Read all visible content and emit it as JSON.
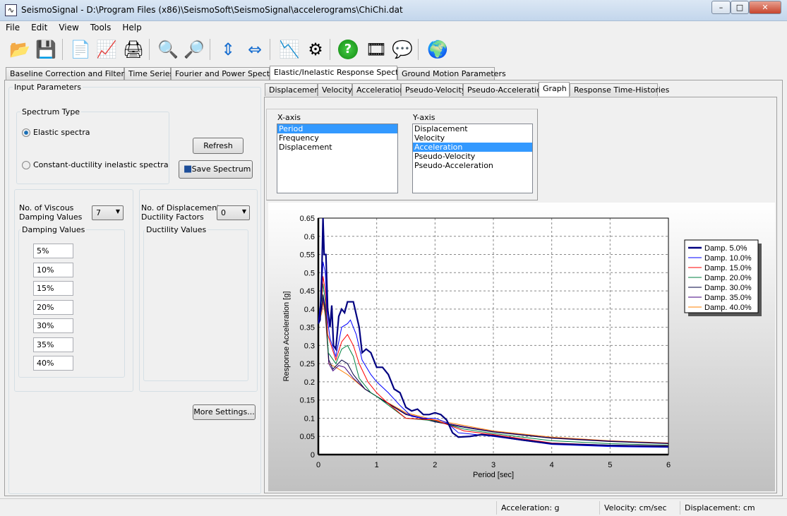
{
  "window": {
    "title": "SeismoSignal - D:\\Program Files (x86)\\SeismoSoft\\SeismoSignal\\accelerograms\\ChiChi.dat",
    "minimize": "–",
    "maximize": "□",
    "close": "✕"
  },
  "menu": [
    "File",
    "Edit",
    "View",
    "Tools",
    "Help"
  ],
  "toolbar": [
    {
      "icon": "open-folder-icon",
      "glyph": "📂"
    },
    {
      "icon": "save-icon",
      "glyph": "💾"
    },
    {
      "icon": "document-icon",
      "glyph": "📄"
    },
    {
      "icon": "signal-document-icon",
      "glyph": "📈"
    },
    {
      "icon": "print-icon",
      "glyph": "🖨"
    },
    {
      "icon": "zoom-in-icon",
      "glyph": "🔍"
    },
    {
      "icon": "zoom-out-icon",
      "glyph": "🔎"
    },
    {
      "icon": "vertical-arrows-icon",
      "glyph": "⇕"
    },
    {
      "icon": "horizontal-arrows-icon",
      "glyph": "⇔"
    },
    {
      "icon": "chart-icon",
      "glyph": "📉"
    },
    {
      "icon": "gear-icon",
      "glyph": "⚙"
    },
    {
      "icon": "help-icon",
      "glyph": "?"
    },
    {
      "icon": "film-reel-icon",
      "glyph": "🎞"
    },
    {
      "icon": "chat-icon",
      "glyph": "💬"
    },
    {
      "icon": "globe-icon",
      "glyph": "🌍"
    }
  ],
  "main_tabs": [
    "Baseline Correction and Filtering",
    "Time Series",
    "Fourier and Power Spectra",
    "Elastic/Inelastic Response Spectra",
    "Ground Motion Parameters"
  ],
  "active_main_tab": 3,
  "input": {
    "title": "Input Parameters",
    "spectrum_type": "Spectrum Type",
    "elastic": "Elastic spectra",
    "inelastic": "Constant-ductility inelastic spectra",
    "selected": "elastic",
    "refresh": "Refresh",
    "save": "Save Spectrum",
    "viscous_label_1": "No. of Viscous",
    "viscous_label_2": "Damping Values",
    "viscous_count": "7",
    "damping_title": "Damping Values",
    "damping_values": [
      "5%",
      "10%",
      "15%",
      "20%",
      "30%",
      "35%",
      "40%"
    ],
    "ductility_label_1": "No. of Displacement",
    "ductility_label_2": "Ductility Factors",
    "ductility_count": "0",
    "ductility_title": "Ductility Values",
    "more": "More Settings..."
  },
  "sub_tabs": [
    "Displacement",
    "Velocity",
    "Acceleration",
    "Pseudo-Velocity",
    "Pseudo-Acceleration",
    "Graph",
    "Response Time-Histories"
  ],
  "active_sub_tab": 5,
  "axes": {
    "x_title": "X-axis",
    "x_options": [
      "Period",
      "Frequency",
      "Displacement"
    ],
    "x_selected": 0,
    "y_title": "Y-axis",
    "y_options": [
      "Displacement",
      "Velocity",
      "Acceleration",
      "Pseudo-Velocity",
      "Pseudo-Acceleration"
    ],
    "y_selected": 2
  },
  "chart_data": {
    "type": "line",
    "xlabel": "Period [sec]",
    "ylabel": "Response Acceleration [g]",
    "xlim": [
      0,
      6
    ],
    "ylim": [
      0,
      0.65
    ],
    "xticks": [
      0,
      1,
      2,
      3,
      4,
      5,
      6
    ],
    "yticks": [
      0,
      0.05,
      0.1,
      0.15,
      0.2,
      0.25,
      0.3,
      0.35,
      0.4,
      0.45,
      0.5,
      0.55,
      0.6,
      0.65
    ],
    "grid": true,
    "legend": "right",
    "series": [
      {
        "name": "Damp. 5.0%",
        "color": "#000080",
        "points": [
          [
            0,
            0.36
          ],
          [
            0.03,
            0.37
          ],
          [
            0.06,
            0.5
          ],
          [
            0.08,
            0.65
          ],
          [
            0.1,
            0.55
          ],
          [
            0.13,
            0.55
          ],
          [
            0.16,
            0.4
          ],
          [
            0.2,
            0.35
          ],
          [
            0.23,
            0.41
          ],
          [
            0.26,
            0.3
          ],
          [
            0.3,
            0.29
          ],
          [
            0.35,
            0.38
          ],
          [
            0.4,
            0.4
          ],
          [
            0.45,
            0.39
          ],
          [
            0.5,
            0.42
          ],
          [
            0.6,
            0.42
          ],
          [
            0.7,
            0.35
          ],
          [
            0.75,
            0.28
          ],
          [
            0.82,
            0.29
          ],
          [
            0.9,
            0.28
          ],
          [
            1.0,
            0.24
          ],
          [
            1.1,
            0.24
          ],
          [
            1.2,
            0.22
          ],
          [
            1.3,
            0.18
          ],
          [
            1.4,
            0.17
          ],
          [
            1.5,
            0.13
          ],
          [
            1.6,
            0.12
          ],
          [
            1.7,
            0.125
          ],
          [
            1.8,
            0.11
          ],
          [
            1.9,
            0.11
          ],
          [
            2.0,
            0.115
          ],
          [
            2.1,
            0.11
          ],
          [
            2.2,
            0.095
          ],
          [
            2.3,
            0.06
          ],
          [
            2.4,
            0.048
          ],
          [
            2.6,
            0.05
          ],
          [
            2.8,
            0.055
          ],
          [
            3,
            0.052
          ],
          [
            3.5,
            0.04
          ],
          [
            4,
            0.03
          ],
          [
            5,
            0.025
          ],
          [
            6,
            0.022
          ]
        ]
      },
      {
        "name": "Damp. 10.0%",
        "color": "#0000ff",
        "points": [
          [
            0,
            0.36
          ],
          [
            0.06,
            0.46
          ],
          [
            0.08,
            0.53
          ],
          [
            0.12,
            0.5
          ],
          [
            0.15,
            0.38
          ],
          [
            0.2,
            0.32
          ],
          [
            0.3,
            0.27
          ],
          [
            0.4,
            0.35
          ],
          [
            0.5,
            0.36
          ],
          [
            0.55,
            0.37
          ],
          [
            0.65,
            0.33
          ],
          [
            0.75,
            0.26
          ],
          [
            0.9,
            0.22
          ],
          [
            1.0,
            0.2
          ],
          [
            1.2,
            0.17
          ],
          [
            1.4,
            0.135
          ],
          [
            1.6,
            0.105
          ],
          [
            1.8,
            0.1
          ],
          [
            2.0,
            0.1
          ],
          [
            2.2,
            0.088
          ],
          [
            2.4,
            0.06
          ],
          [
            2.7,
            0.055
          ],
          [
            3,
            0.05
          ],
          [
            4,
            0.028
          ],
          [
            5,
            0.022
          ],
          [
            6,
            0.02
          ]
        ]
      },
      {
        "name": "Damp. 15.0%",
        "color": "#ff0000",
        "points": [
          [
            0,
            0.36
          ],
          [
            0.06,
            0.44
          ],
          [
            0.08,
            0.49
          ],
          [
            0.12,
            0.45
          ],
          [
            0.16,
            0.33
          ],
          [
            0.22,
            0.3
          ],
          [
            0.3,
            0.26
          ],
          [
            0.4,
            0.31
          ],
          [
            0.5,
            0.33
          ],
          [
            0.6,
            0.3
          ],
          [
            0.7,
            0.25
          ],
          [
            0.85,
            0.2
          ],
          [
            1,
            0.17
          ],
          [
            1.2,
            0.14
          ],
          [
            1.5,
            0.1
          ],
          [
            2,
            0.095
          ],
          [
            2.5,
            0.065
          ],
          [
            3,
            0.055
          ],
          [
            4,
            0.032
          ],
          [
            5,
            0.026
          ],
          [
            6,
            0.024
          ]
        ]
      },
      {
        "name": "Damp. 20.0%",
        "color": "#008040",
        "points": [
          [
            0,
            0.36
          ],
          [
            0.06,
            0.43
          ],
          [
            0.08,
            0.47
          ],
          [
            0.12,
            0.42
          ],
          [
            0.17,
            0.28
          ],
          [
            0.3,
            0.25
          ],
          [
            0.4,
            0.29
          ],
          [
            0.5,
            0.3
          ],
          [
            0.6,
            0.27
          ],
          [
            0.7,
            0.21
          ],
          [
            0.9,
            0.17
          ],
          [
            1,
            0.16
          ],
          [
            1.5,
            0.1
          ],
          [
            2,
            0.093
          ],
          [
            2.5,
            0.07
          ],
          [
            3,
            0.058
          ],
          [
            4,
            0.038
          ],
          [
            5,
            0.03
          ],
          [
            6,
            0.026
          ]
        ]
      },
      {
        "name": "Damp. 30.0%",
        "color": "#000040",
        "points": [
          [
            0,
            0.36
          ],
          [
            0.06,
            0.41
          ],
          [
            0.08,
            0.44
          ],
          [
            0.12,
            0.4
          ],
          [
            0.18,
            0.26
          ],
          [
            0.25,
            0.235
          ],
          [
            0.4,
            0.26
          ],
          [
            0.5,
            0.25
          ],
          [
            0.6,
            0.22
          ],
          [
            0.8,
            0.18
          ],
          [
            1,
            0.16
          ],
          [
            1.5,
            0.11
          ],
          [
            2,
            0.09
          ],
          [
            2.5,
            0.075
          ],
          [
            3,
            0.062
          ],
          [
            4,
            0.045
          ],
          [
            5,
            0.036
          ],
          [
            6,
            0.03
          ]
        ]
      },
      {
        "name": "Damp. 35.0%",
        "color": "#400080",
        "points": [
          [
            0,
            0.36
          ],
          [
            0.06,
            0.4
          ],
          [
            0.08,
            0.43
          ],
          [
            0.12,
            0.39
          ],
          [
            0.18,
            0.25
          ],
          [
            0.25,
            0.23
          ],
          [
            0.35,
            0.245
          ],
          [
            0.45,
            0.24
          ],
          [
            0.6,
            0.21
          ],
          [
            0.8,
            0.18
          ],
          [
            1,
            0.16
          ],
          [
            1.5,
            0.112
          ],
          [
            2,
            0.092
          ],
          [
            2.5,
            0.077
          ],
          [
            3,
            0.063
          ],
          [
            4,
            0.046
          ],
          [
            5,
            0.037
          ],
          [
            6,
            0.031
          ]
        ]
      },
      {
        "name": "Damp. 40.0%",
        "color": "#ff8000",
        "points": [
          [
            0,
            0.36
          ],
          [
            0.06,
            0.39
          ],
          [
            0.08,
            0.42
          ],
          [
            0.12,
            0.38
          ],
          [
            0.18,
            0.25
          ],
          [
            0.3,
            0.24
          ],
          [
            0.5,
            0.22
          ],
          [
            0.8,
            0.18
          ],
          [
            1,
            0.16
          ],
          [
            1.5,
            0.115
          ],
          [
            2,
            0.095
          ],
          [
            2.5,
            0.08
          ],
          [
            3,
            0.065
          ],
          [
            4,
            0.048
          ],
          [
            5,
            0.038
          ],
          [
            6,
            0.032
          ]
        ]
      }
    ]
  },
  "status": [
    "Acceleration: g",
    "Velocity: cm/sec",
    "Displacement: cm"
  ]
}
